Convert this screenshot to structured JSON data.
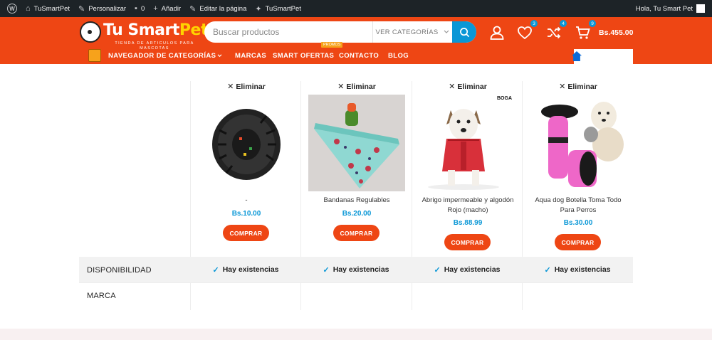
{
  "adminbar": {
    "site_name": "TuSmartPet",
    "customize": "Personalizar",
    "comments_count": "0",
    "add_new": "Añadir",
    "edit_page": "Editar la página",
    "plugin_item": "TuSmartPet",
    "greeting": "Hola, Tu Smart Pet"
  },
  "header": {
    "logo_name_part1": "Tu Smart",
    "logo_name_part2": "Pet",
    "logo_tagline": "TIENDA DE ARTICULOS PARA MASCOTAS",
    "search_placeholder": "Buscar productos",
    "search_category": "VER CATEGORÍAS",
    "wishlist_count": "3",
    "compare_count": "4",
    "cart_count": "9",
    "cart_total": "Bs.455.00"
  },
  "nav": {
    "categories_label": "NAVEGADOR DE CATEGORÍAS",
    "links": [
      "MARCAS",
      "SMART OFERTAS",
      "CONTACTO",
      "BLOG"
    ],
    "promo_badge": "PROMOS"
  },
  "compare": {
    "remove_label": "Eliminar",
    "buy_label": "COMPRAR",
    "products": [
      {
        "name": "-",
        "price": "Bs.10.00",
        "availability": "Hay existencias"
      },
      {
        "name": "Bandanas Regulables",
        "price": "Bs.20.00",
        "availability": "Hay existencias"
      },
      {
        "name": "Abrigo impermeable y algodón Rojo (macho)",
        "price": "Bs.88.99",
        "availability": "Hay existencias",
        "brand_stamp": "BOGA"
      },
      {
        "name": "Aqua dog Botella Toma Todo Para Perros",
        "price": "Bs.30.00",
        "availability": "Hay existencias"
      }
    ],
    "rows": {
      "availability_label": "DISPONIBILIDAD",
      "brand_label": "MARCA"
    }
  },
  "colors": {
    "brand_orange": "#ee4614",
    "accent_blue": "#0a97d6",
    "admin_bar": "#1d2327"
  }
}
